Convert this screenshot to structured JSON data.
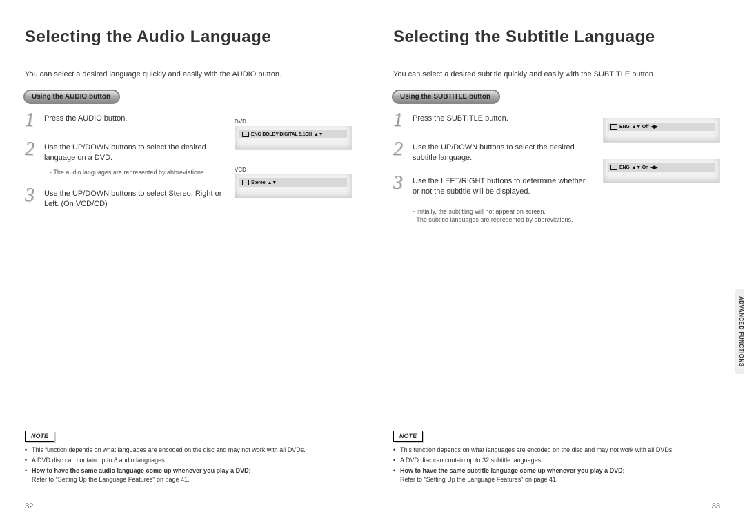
{
  "left": {
    "title": "Selecting the Audio Language",
    "intro": "You can select a desired language quickly and easily with the AUDIO button.",
    "pill": "Using the AUDIO button",
    "steps": {
      "s1": "Press the AUDIO button.",
      "s2": "Use the UP/DOWN buttons to select the desired language on a DVD.",
      "s2_sub": "- The audio languages are represented by abbreviations.",
      "s3": "Use the UP/DOWN buttons to select Stereo, Right or Left. (On VCD/CD)"
    },
    "screens": {
      "dvd_label": "DVD",
      "dvd_bar": "ENG DOLBY DIGITAL 5.1CH",
      "vcd_label": "VCD",
      "vcd_bar": "Stereo"
    },
    "note_label": "NOTE",
    "notes": {
      "n1": "This function depends on what languages are encoded on the disc and may not work with all DVDs.",
      "n2": "A DVD disc can contain up to 8 audio languages.",
      "n3_bold": "How to have the same audio language come up whenever you play a DVD;",
      "n3_sub": "Refer to \"Setting Up the Language Features\" on page 41."
    },
    "pagenum": "32"
  },
  "right": {
    "title": "Selecting the Subtitle Language",
    "intro": "You can select a desired subtitle quickly and easily with the SUBTITLE button.",
    "pill": "Using the SUBTITLE button",
    "steps": {
      "s1": "Press the SUBTITLE button.",
      "s2": "Use the UP/DOWN buttons to select the desired subtitle language.",
      "s3": "Use the LEFT/RIGHT buttons to determine whether or not the subtitle will be displayed.",
      "sub1": "- Initially, the subtitling will not appear on screen.",
      "sub2": "- The subtitle languages are represented by abbreviations."
    },
    "screens": {
      "bar1_a": "ENG",
      "bar1_b": "Off",
      "bar2_a": "ENG",
      "bar2_b": "On"
    },
    "tab": "ADVANCED FUNCTIONS",
    "note_label": "NOTE",
    "notes": {
      "n1": "This function depends on what languages are encoded on the disc and may not work with all DVDs.",
      "n2": "A DVD disc can contain up to 32 subtitle languages.",
      "n3_bold": "How to have the same subtitle language come up whenever you play a DVD;",
      "n3_sub": "Refer to \"Setting Up the Language Features\" on page 41."
    },
    "pagenum": "33"
  }
}
